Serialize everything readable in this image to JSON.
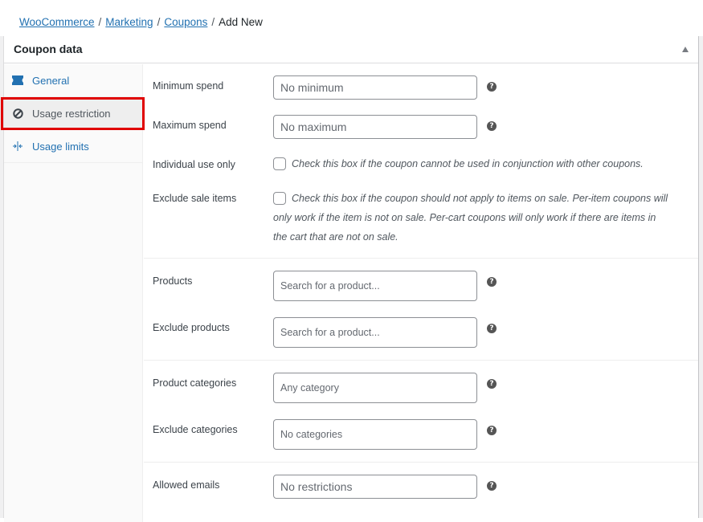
{
  "breadcrumb": {
    "items": [
      {
        "label": "WooCommerce",
        "link": true
      },
      {
        "label": "Marketing",
        "link": true
      },
      {
        "label": "Coupons",
        "link": true
      },
      {
        "label": "Add New",
        "link": false
      }
    ],
    "separator": "/"
  },
  "panel": {
    "title": "Coupon data",
    "toggle_icon": "triangle-up-icon"
  },
  "tabs": [
    {
      "label": "General",
      "icon": "ticket-icon",
      "active": false
    },
    {
      "label": "Usage restriction",
      "icon": "forbidden-icon",
      "active": true
    },
    {
      "label": "Usage limits",
      "icon": "limits-icon",
      "active": false
    }
  ],
  "fields": {
    "minimum_spend": {
      "label": "Minimum spend",
      "placeholder": "No minimum",
      "value": ""
    },
    "maximum_spend": {
      "label": "Maximum spend",
      "placeholder": "No maximum",
      "value": ""
    },
    "individual_use": {
      "label": "Individual use only",
      "checked": false,
      "description": "Check this box if the coupon cannot be used in conjunction with other coupons."
    },
    "exclude_sale_items": {
      "label": "Exclude sale items",
      "checked": false,
      "description_lines": [
        "Check this box if the coupon should not apply to items on sale. Per-item coupons will",
        "only work if the item is not on sale. Per-cart coupons will only work if there are items in",
        "the cart that are not on sale."
      ]
    },
    "products": {
      "label": "Products",
      "placeholder": "Search for a product..."
    },
    "exclude_products": {
      "label": "Exclude products",
      "placeholder": "Search for a product..."
    },
    "product_categories": {
      "label": "Product categories",
      "placeholder": "Any category"
    },
    "exclude_categories": {
      "label": "Exclude categories",
      "placeholder": "No categories"
    },
    "allowed_emails": {
      "label": "Allowed emails",
      "placeholder": "No restrictions",
      "value": ""
    }
  },
  "help_icon_glyph": "?",
  "colors": {
    "link": "#2271b1",
    "highlight_border": "#e00000",
    "help_icon_bg": "#555555"
  }
}
